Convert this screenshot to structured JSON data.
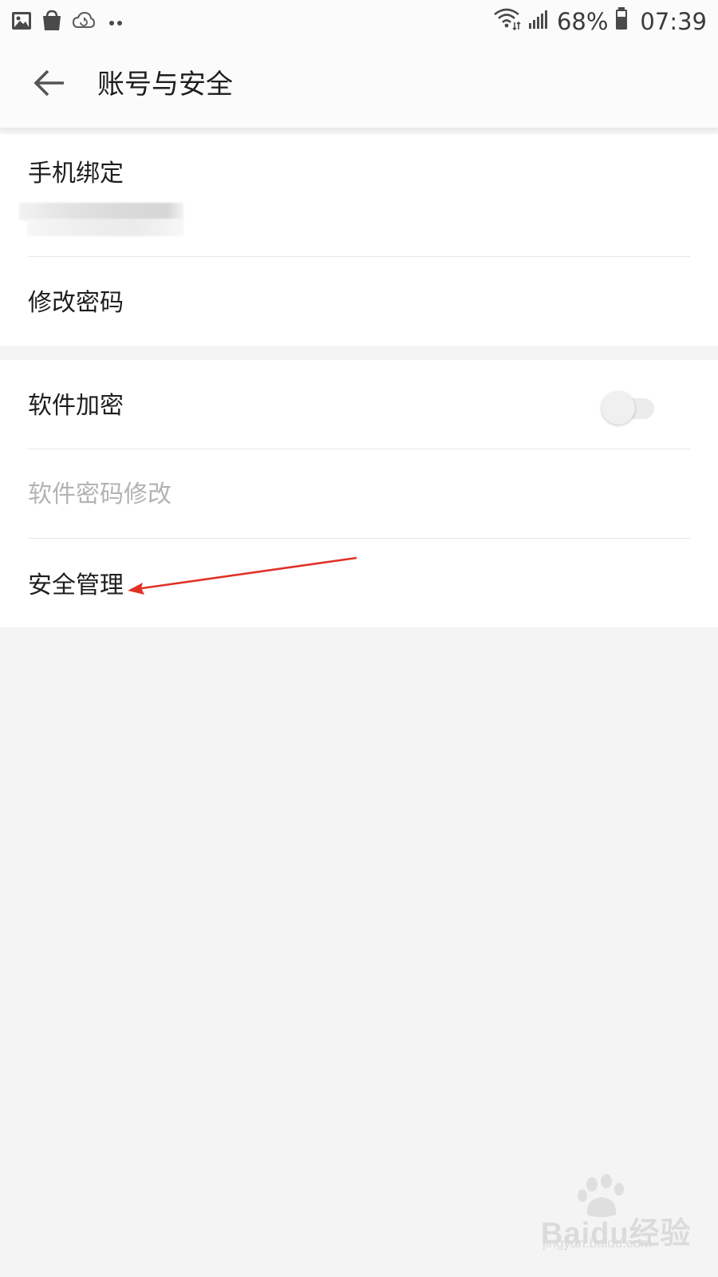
{
  "status_bar": {
    "left_icons": [
      "image-icon",
      "shopping-bag-icon",
      "cloud-sync-icon",
      "more-dots-icon"
    ],
    "battery_percent": "68%",
    "time": "07:39"
  },
  "header": {
    "title": "账号与安全"
  },
  "section_account": {
    "phone_binding_label": "手机绑定",
    "change_password_label": "修改密码"
  },
  "section_security": {
    "app_encryption_label": "软件加密",
    "app_encryption_enabled": false,
    "app_password_change_label": "软件密码修改",
    "security_management_label": "安全管理"
  },
  "watermark": {
    "logo_text": "Baidu经验",
    "url": "jingyan.baidu.com"
  },
  "colors": {
    "background": "#f4f4f4",
    "card": "#ffffff",
    "annotation_arrow": "#e03127",
    "disabled_text": "#b3b3b3"
  }
}
